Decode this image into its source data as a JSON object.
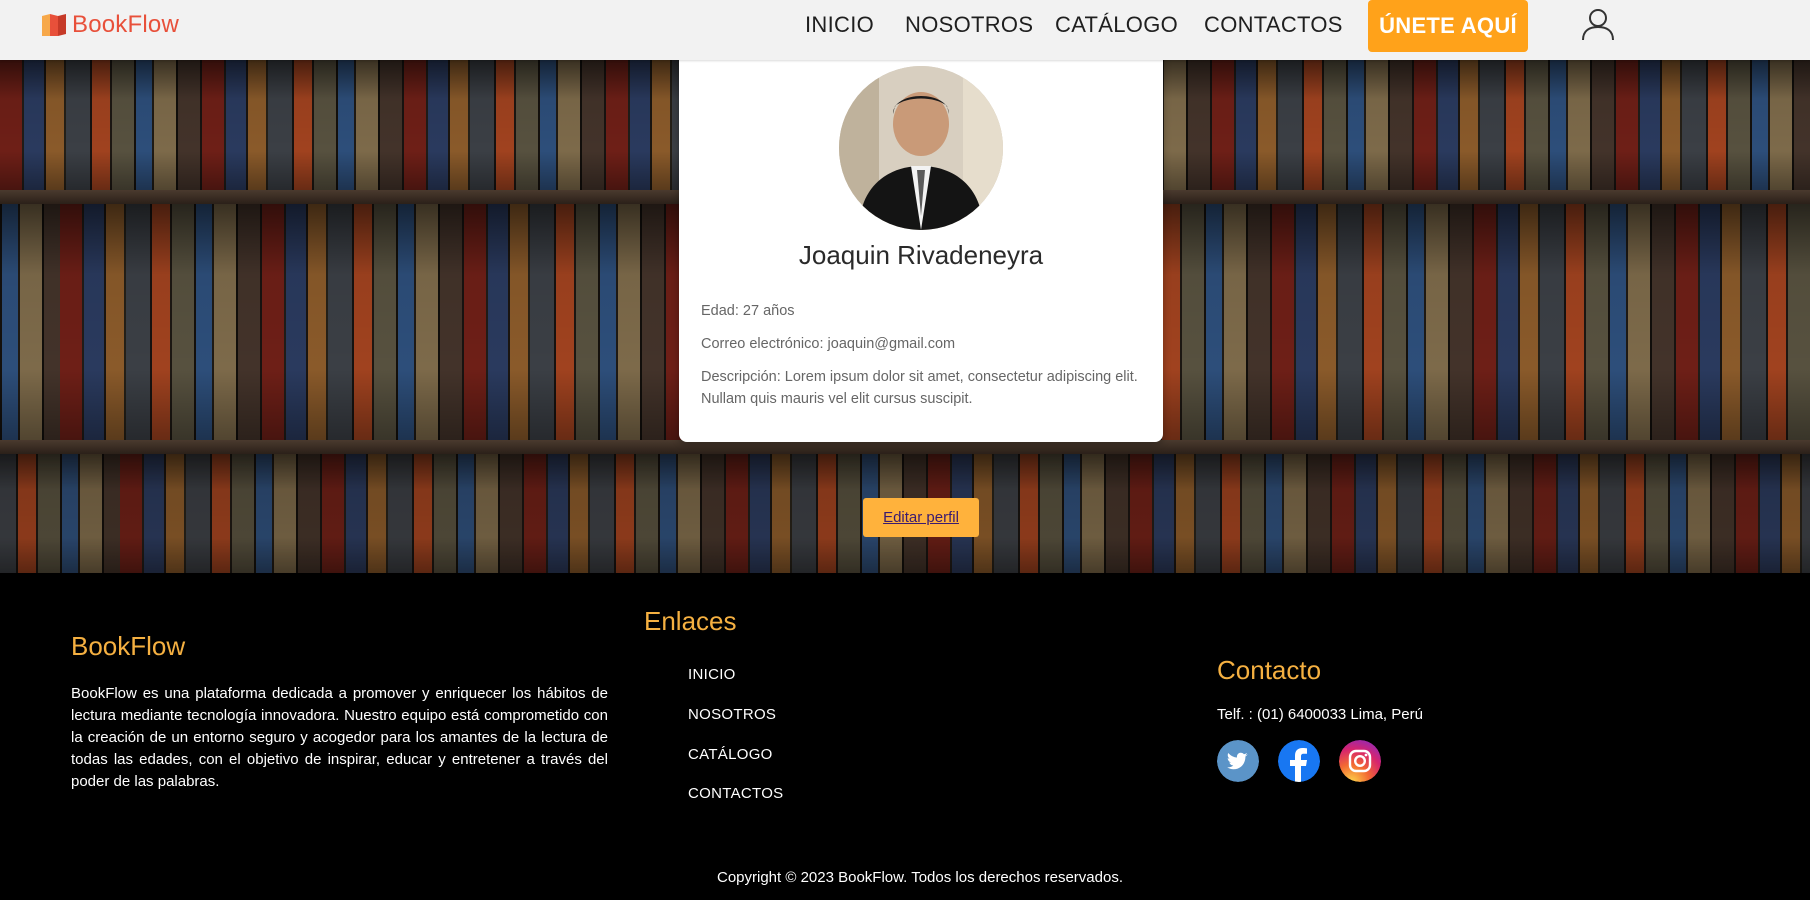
{
  "brand": {
    "name": "BookFlow",
    "color": "#e8503a"
  },
  "nav": {
    "items": [
      "INICIO",
      "NOSOTROS",
      "CATÁLOGO",
      "CONTACTOS"
    ],
    "cta_label": "ÚNETE AQUÍ",
    "cta_color": "#ffa21a",
    "user_icon": "user-icon"
  },
  "profile": {
    "name": "Joaquin Rivadeneyra",
    "age": "Edad: 27 años",
    "email": "Correo electrónico: joaquin@gmail.com",
    "description": "Descripción: Lorem ipsum dolor sit amet, consectetur adipiscing elit. Nullam quis mauris vel elit cursus suscipit."
  },
  "edit_button": {
    "label": "Editar perfil",
    "color": "#ffb23c"
  },
  "footer": {
    "about": {
      "title": "BookFlow",
      "text": "BookFlow es una plataforma dedicada a promover y enriquecer los hábitos de lectura mediante tecnología innovadora. Nuestro equipo está comprometido con la creación de un entorno seguro y acogedor para los amantes de la lectura de todas las edades, con el objetivo de inspirar, educar y entretener a través del poder de las palabras."
    },
    "links": {
      "title": "Enlaces",
      "items": [
        "INICIO",
        "NOSOTROS",
        "CATÁLOGO",
        "CONTACTOS"
      ]
    },
    "contact": {
      "title": "Contacto",
      "phone": "Telf. : (01) 6400033 Lima, Perú",
      "social": [
        "twitter-icon",
        "facebook-icon",
        "instagram-icon"
      ]
    },
    "heading_color": "#f5b041",
    "copyright": "Copyright © 2023 BookFlow. Todos los derechos reservados."
  }
}
